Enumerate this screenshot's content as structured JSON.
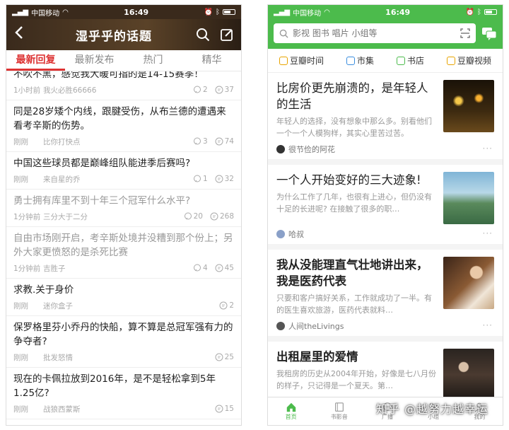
{
  "left": {
    "status": {
      "carrier": "中国移动",
      "time": "16:49"
    },
    "title": "湿乎乎的话题",
    "tabs": [
      {
        "label": "最新回复",
        "active": true
      },
      {
        "label": "最新发布",
        "active": false
      },
      {
        "label": "热门",
        "active": false
      },
      {
        "label": "精华",
        "active": false
      }
    ],
    "cut_text": "不吹不黑，感觉我大暖可指的是14-15赛季！",
    "posts": [
      {
        "title": "",
        "time": "1小时前",
        "user": "我火必胜66666",
        "likes": "2",
        "comments": "37",
        "read": false,
        "partial": true
      },
      {
        "title": "同是28岁矮个内线，跟腱受伤，从布兰德的遭遇来看考辛斯的伤势。",
        "time": "刚刚",
        "user": "比你打快点",
        "likes": "3",
        "comments": "74",
        "read": false
      },
      {
        "title": "中国这些球员都是巅峰组队能进季后赛吗?",
        "time": "刚刚",
        "user": "来自星的乔",
        "likes": "1",
        "comments": "32",
        "read": false
      },
      {
        "title": "勇士拥有库里不到十年三个冠军什么水平?",
        "time": "1分钟前",
        "user": "三分大于二分",
        "likes": "20",
        "comments": "268",
        "read": true
      },
      {
        "title": "自由市场刚开启，考辛斯处境并没糟到那个份上；另外大家更愤怒的是杀死比赛",
        "time": "1分钟前",
        "user": "吉胜子",
        "likes": "4",
        "comments": "45",
        "read": true
      },
      {
        "title": "求教.关于身价",
        "time": "刚刚",
        "user": "迷你盒子",
        "likes": "",
        "comments": "2",
        "read": false
      },
      {
        "title": "保罗格里芬小乔丹的快船，算不算是总冠军强有力的争夺者?",
        "time": "刚刚",
        "user": "批发怒情",
        "likes": "",
        "comments": "25",
        "read": false
      },
      {
        "title": "现在的卡佩拉放到2016年，是不是轻松拿到5年1.25亿?",
        "time": "刚刚",
        "user": "战狼西蒙斯",
        "likes": "",
        "comments": "15",
        "read": false
      }
    ]
  },
  "right": {
    "status": {
      "carrier": "中国移动",
      "time": "16:49"
    },
    "search": {
      "placeholder": "影视 图书 唱片 小组等"
    },
    "channels": [
      {
        "label": "豆瓣时间",
        "color": "#e8a400"
      },
      {
        "label": "市集",
        "color": "#3a8dde"
      },
      {
        "label": "书店",
        "color": "#4cbb4c"
      },
      {
        "label": "豆瓣视频",
        "color": "#e8a400"
      }
    ],
    "cards": [
      {
        "title": "比房价更先崩溃的，是年轻人的生活",
        "desc": "年轻人的选择，没有想象中那么多。别看他们一个一个人模狗样，其实心里苦过苦。",
        "author": "很节俭的阿花",
        "pic": "night-road",
        "bold": false
      },
      {
        "title": "一个人开始变好的三大迹象!",
        "desc": "为什么工作了几年，也很有上进心，但仍没有十足的长进呢? 在接触了很多的职…",
        "author": "哈叔",
        "pic": "city-view",
        "bold": false
      },
      {
        "title": "我从没能理直气壮地讲出来，我是医药代表",
        "desc": "只要和客户搞好关系，工作就成功了一半。有的医生喜欢旅游，医药代表就料…",
        "author": "人间theLivings",
        "pic": "woman-books",
        "bold": true
      },
      {
        "title": "出租屋里的爱情",
        "desc": "我租房的历史从2004年开始，好像是七八月份的样子，只记得是一个夏天。第…",
        "author": "",
        "pic": "couple",
        "bold": true
      }
    ],
    "nav": [
      {
        "label": "首页",
        "active": true
      },
      {
        "label": "书影音",
        "active": false
      },
      {
        "label": "广播",
        "active": false
      },
      {
        "label": "小组",
        "active": false
      },
      {
        "label": "我的",
        "active": false
      }
    ],
    "watermark": "知乎 @越努力越幸运"
  }
}
